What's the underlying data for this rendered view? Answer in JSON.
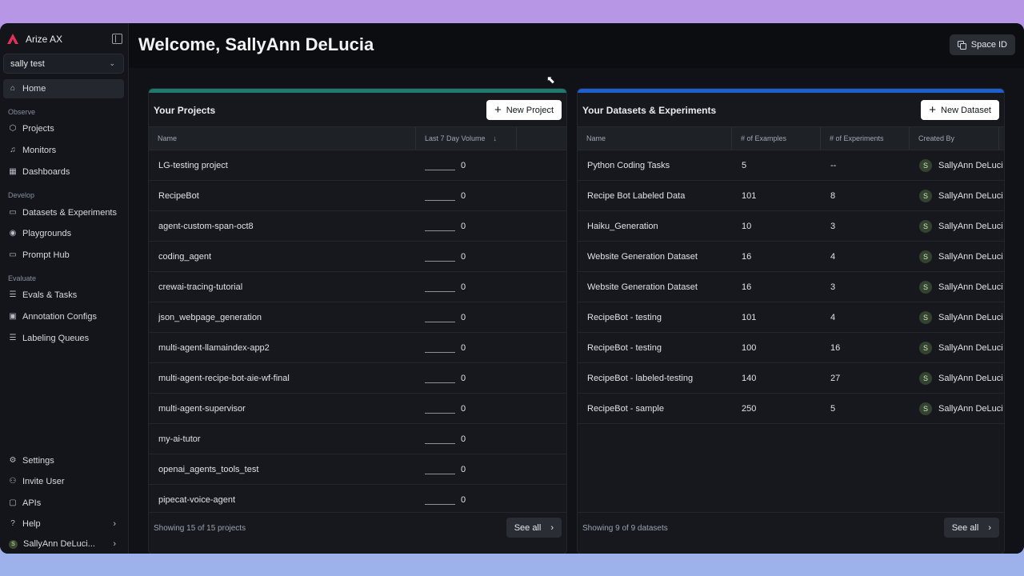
{
  "app": {
    "name": "Arize AX"
  },
  "space": {
    "selected": "sally test"
  },
  "sidebar": {
    "home": "Home",
    "sections": {
      "observe": "Observe",
      "develop": "Develop",
      "evaluate": "Evaluate"
    },
    "observe": [
      "Projects",
      "Monitors",
      "Dashboards"
    ],
    "develop": [
      "Datasets & Experiments",
      "Playgrounds",
      "Prompt Hub"
    ],
    "evaluate": [
      "Evals & Tasks",
      "Annotation Configs",
      "Labeling Queues"
    ],
    "bottom": {
      "settings": "Settings",
      "invite": "Invite User",
      "apis": "APIs",
      "help": "Help",
      "user": "SallyAnn DeLuci...",
      "user_initial": "S"
    }
  },
  "header": {
    "title": "Welcome, SallyAnn DeLucia",
    "space_id": "Space ID"
  },
  "projects": {
    "title": "Your Projects",
    "new_button": "New Project",
    "columns": {
      "name": "Name",
      "volume": "Last 7 Day Volume"
    },
    "rows": [
      {
        "name": "LG-testing project",
        "volume": "0"
      },
      {
        "name": "RecipeBot",
        "volume": "0"
      },
      {
        "name": "agent-custom-span-oct8",
        "volume": "0"
      },
      {
        "name": "coding_agent",
        "volume": "0"
      },
      {
        "name": "crewai-tracing-tutorial",
        "volume": "0"
      },
      {
        "name": "json_webpage_generation",
        "volume": "0"
      },
      {
        "name": "multi-agent-llamaindex-app2",
        "volume": "0"
      },
      {
        "name": "multi-agent-recipe-bot-aie-wf-final",
        "volume": "0"
      },
      {
        "name": "multi-agent-supervisor",
        "volume": "0"
      },
      {
        "name": "my-ai-tutor",
        "volume": "0"
      },
      {
        "name": "openai_agents_tools_test",
        "volume": "0"
      },
      {
        "name": "pipecat-voice-agent",
        "volume": "0"
      }
    ],
    "footer": "Showing 15 of 15 projects",
    "see_all": "See all",
    "accent": "#1f7a6d"
  },
  "datasets": {
    "title": "Your Datasets & Experiments",
    "new_button": "New Dataset",
    "columns": {
      "name": "Name",
      "examples": "# of Examples",
      "experiments": "# of Experiments",
      "created_by": "Created By"
    },
    "rows": [
      {
        "name": "Python Coding Tasks",
        "examples": "5",
        "experiments": "--",
        "created_by": "SallyAnn DeLuci",
        "initial": "S"
      },
      {
        "name": "Recipe Bot Labeled Data",
        "examples": "101",
        "experiments": "8",
        "created_by": "SallyAnn DeLuci",
        "initial": "S"
      },
      {
        "name": "Haiku_Generation",
        "examples": "10",
        "experiments": "3",
        "created_by": "SallyAnn DeLuci",
        "initial": "S"
      },
      {
        "name": "Website Generation Dataset",
        "examples": "16",
        "experiments": "4",
        "created_by": "SallyAnn DeLuci",
        "initial": "S"
      },
      {
        "name": "Website Generation Dataset",
        "examples": "16",
        "experiments": "3",
        "created_by": "SallyAnn DeLuci",
        "initial": "S"
      },
      {
        "name": "RecipeBot - testing",
        "examples": "101",
        "experiments": "4",
        "created_by": "SallyAnn DeLuci",
        "initial": "S"
      },
      {
        "name": "RecipeBot - testing",
        "examples": "100",
        "experiments": "16",
        "created_by": "SallyAnn DeLuci",
        "initial": "S"
      },
      {
        "name": "RecipeBot - labeled-testing",
        "examples": "140",
        "experiments": "27",
        "created_by": "SallyAnn DeLuci",
        "initial": "S"
      },
      {
        "name": "RecipeBot - sample",
        "examples": "250",
        "experiments": "5",
        "created_by": "SallyAnn DeLuci",
        "initial": "S"
      }
    ],
    "footer": "Showing 9 of 9 datasets",
    "see_all": "See all",
    "accent": "#1e5fd0"
  }
}
